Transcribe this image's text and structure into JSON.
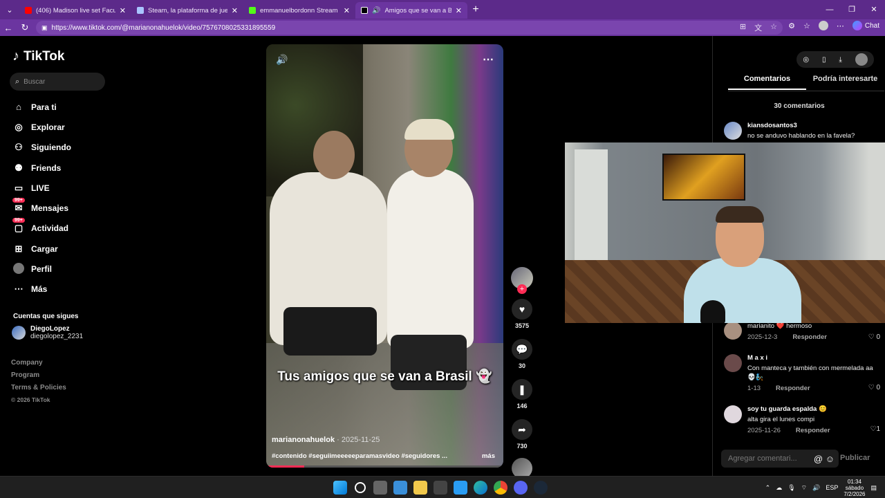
{
  "browser": {
    "tabs": [
      {
        "title": "(406) Madison live set Facu romano",
        "color": "#ff0000"
      },
      {
        "title": "Steam, la plataforma de juegos c",
        "color": "#a9c5ff"
      },
      {
        "title": "emmanuelbordonn Stream - Watc",
        "color": "#53fc18"
      },
      {
        "title": "Amigos que se van a Brasil",
        "color": "#000000"
      }
    ],
    "url": "https://www.tiktok.com/@marianonahuelok/video/7576708025331895559",
    "chat_label": "Chat"
  },
  "tiktok": {
    "logo": "TikTok",
    "search_placeholder": "Buscar",
    "nav": [
      {
        "label": "Para ti",
        "icon": "home-icon"
      },
      {
        "label": "Explorar",
        "icon": "compass-icon"
      },
      {
        "label": "Siguiendo",
        "icon": "following-icon"
      },
      {
        "label": "Friends",
        "icon": "friends-icon"
      },
      {
        "label": "LIVE",
        "icon": "live-icon"
      },
      {
        "label": "Mensajes",
        "icon": "messages-icon",
        "badge": "99+"
      },
      {
        "label": "Actividad",
        "icon": "activity-icon",
        "badge": "99+"
      },
      {
        "label": "Cargar",
        "icon": "upload-icon"
      },
      {
        "label": "Perfil",
        "icon": "profile-icon"
      },
      {
        "label": "Más",
        "icon": "more-icon"
      }
    ],
    "following_title": "Cuentas que sigues",
    "following": [
      {
        "name": "DiegoLopez",
        "handle": "diegolopez_2231"
      }
    ],
    "footer": [
      "Company",
      "Program",
      "Terms & Policies",
      "© 2026 TikTok"
    ]
  },
  "video": {
    "caption": "Tus amigos que se van a Brasil 👻",
    "author": "marianonahuelok",
    "date": "· 2025-11-25",
    "tags": "#contenido #seguiimeeeeeparamasvideo #seguidores ...",
    "more": "más",
    "progress": 0.16,
    "likes": "3575",
    "comments": "30",
    "saves": "146",
    "shares": "730"
  },
  "comments_panel": {
    "tabs": [
      "Comentarios",
      "Podría interesarte"
    ],
    "count": "30 comentarios",
    "items": [
      {
        "user": "kiansdosantos3",
        "text": "no se anduvo hablando en la favela?",
        "date": "",
        "reply": "",
        "likes": ""
      },
      {
        "user": "",
        "text": "marianito ❤️ hermoso",
        "date": "2025-12-3",
        "reply": "Responder",
        "likes": "0"
      },
      {
        "user": "M a x i",
        "text": "Con manteca y también con mermelada aa 💀🧞",
        "date": "1-13",
        "reply": "Responder",
        "likes": "0"
      },
      {
        "user": "soy tu guarda espalda 😊",
        "text": "alta gira el lunes compi",
        "date": "2025-11-26",
        "reply": "Responder",
        "likes": "1"
      }
    ],
    "input_placeholder": "Agregar comentari...",
    "publish": "Publicar"
  },
  "taskbar": {
    "lang": "ESP",
    "time": "01:34",
    "day": "sábado",
    "date": "7/2/2026"
  }
}
